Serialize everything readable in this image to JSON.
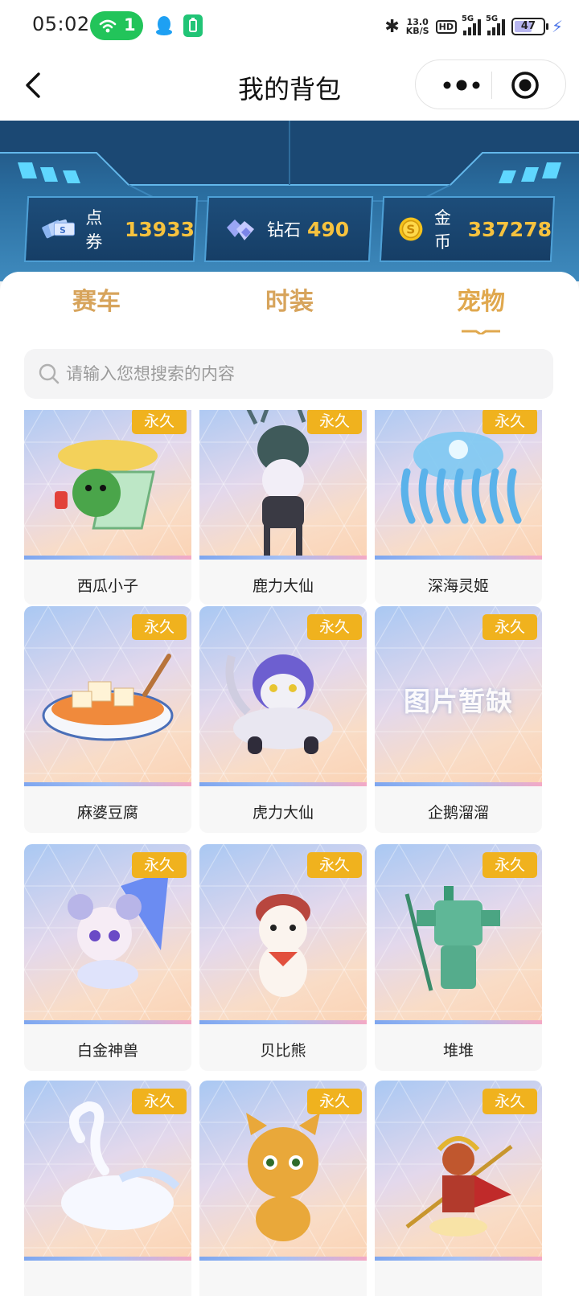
{
  "status_bar": {
    "time": "05:02",
    "hotspot_count": "1",
    "net_speed_value": "13.0",
    "net_speed_unit": "KB/S",
    "hd_label": "HD",
    "signal1_label": "5G",
    "signal2_label": "5G",
    "battery": "47",
    "accent": "#22c45a"
  },
  "nav": {
    "title": "我的背包",
    "back_icon": "chevron-left-icon",
    "more_icon": "more-dots-icon",
    "close_icon": "target-close-icon"
  },
  "currencies": [
    {
      "label": "点券",
      "value": "13933",
      "icon": "ticket-cards-icon"
    },
    {
      "label": "钻石",
      "value": "490",
      "icon": "diamond-icon"
    },
    {
      "label": "金币",
      "value": "337278",
      "icon": "gold-coin-icon"
    }
  ],
  "tabs": [
    {
      "label": "赛车",
      "active": false
    },
    {
      "label": "时装",
      "active": false
    },
    {
      "label": "宠物",
      "active": true
    }
  ],
  "search": {
    "placeholder": "请输入您想搜索的内容"
  },
  "pets": [
    {
      "name": "西瓜小子",
      "badge": "永久",
      "art": "watermelon-boy-image"
    },
    {
      "name": "鹿力大仙",
      "badge": "永久",
      "art": "deer-immortal-image"
    },
    {
      "name": "深海灵姬",
      "badge": "永久",
      "art": "jellyfish-spirit-image"
    },
    {
      "name": "麻婆豆腐",
      "badge": "永久",
      "art": "mapo-tofu-image"
    },
    {
      "name": "虎力大仙",
      "badge": "永久",
      "art": "tiger-immortal-image"
    },
    {
      "name": "企鹅溜溜",
      "badge": "永久",
      "art": "image-missing-placeholder",
      "missing_text": "图片暂缺"
    },
    {
      "name": "白金神兽",
      "badge": "永久",
      "art": "platinum-beast-image"
    },
    {
      "name": "贝比熊",
      "badge": "永久",
      "art": "baby-bear-image"
    },
    {
      "name": "堆堆",
      "badge": "永久",
      "art": "bronze-mask-figure-image"
    },
    {
      "name": "",
      "badge": "永久",
      "art": "swan-image"
    },
    {
      "name": "",
      "badge": "永久",
      "art": "tiger-cub-image"
    },
    {
      "name": "",
      "badge": "永久",
      "art": "monkey-king-image"
    }
  ]
}
